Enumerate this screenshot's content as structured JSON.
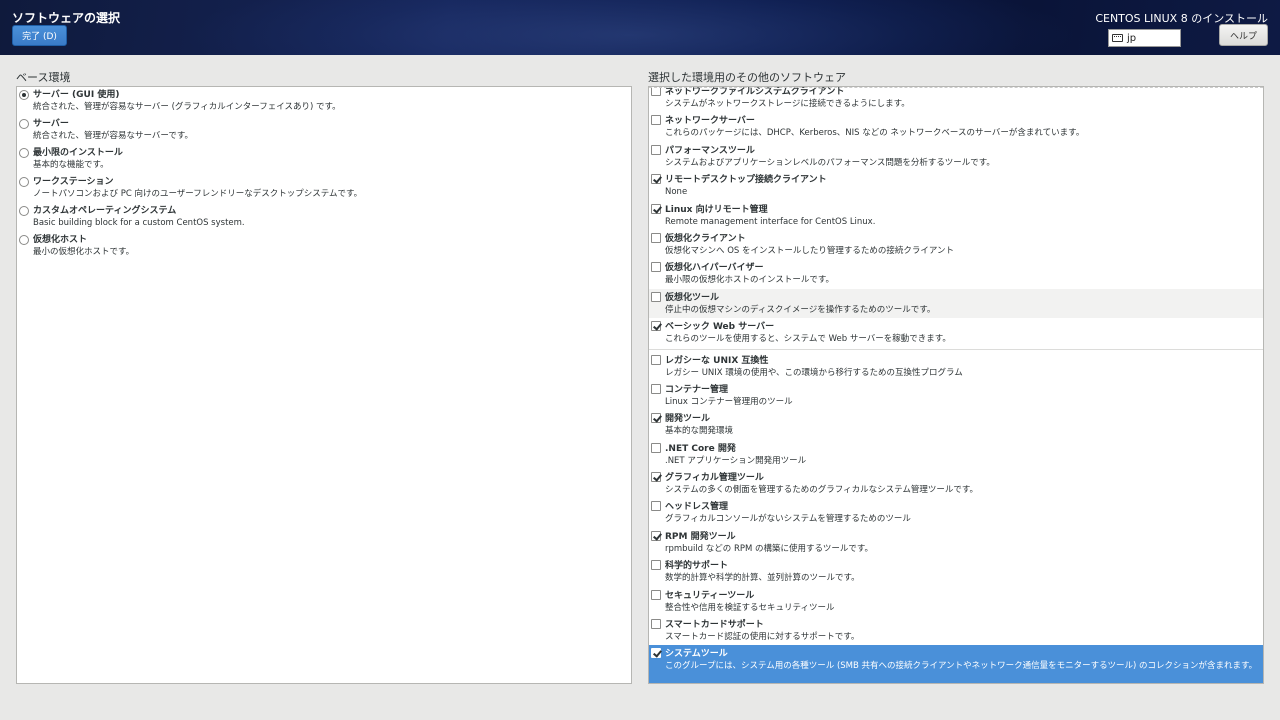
{
  "header": {
    "spoke_title": "ソフトウェアの選択",
    "done_label": "完了 (D)",
    "product_title": "CENTOS LINUX 8 のインストール",
    "keyboard_layout": "jp",
    "help_label": "ヘルプ"
  },
  "base_environment": {
    "label": "ベース環境",
    "items": [
      {
        "name": "サーバー (GUI 使用)",
        "desc": "統合された、管理が容易なサーバー (グラフィカルインターフェイスあり) です。",
        "selected": true
      },
      {
        "name": "サーバー",
        "desc": "統合された、管理が容易なサーバーです。",
        "selected": false
      },
      {
        "name": "最小限のインストール",
        "desc": "基本的な機能です。",
        "selected": false
      },
      {
        "name": "ワークステーション",
        "desc": "ノートパソコンおよび PC 向けのユーザーフレンドリーなデスクトップシステムです。",
        "selected": false
      },
      {
        "name": "カスタムオペレーティングシステム",
        "desc": "Basic building block for a custom CentOS system.",
        "selected": false
      },
      {
        "name": "仮想化ホスト",
        "desc": "最小の仮想化ホストです。",
        "selected": false
      }
    ]
  },
  "addons": {
    "label": "選択した環境用のその他のソフトウェア",
    "items": [
      {
        "name": "ネットワークファイルシステムクライアント",
        "desc": "システムがネットワークストレージに接続できるようにします。",
        "checked": false
      },
      {
        "name": "ネットワークサーバー",
        "desc": "これらのパッケージには、DHCP、Kerberos、NIS などの ネットワークベースのサーバーが含まれています。",
        "checked": false
      },
      {
        "name": "パフォーマンスツール",
        "desc": "システムおよびアプリケーションレベルのパフォーマンス問題を分析するツールです。",
        "checked": false
      },
      {
        "name": "リモートデスクトップ接続クライアント",
        "desc": "None",
        "checked": true
      },
      {
        "name": "Linux 向けリモート管理",
        "desc": "Remote management interface for CentOS Linux.",
        "checked": true
      },
      {
        "name": "仮想化クライアント",
        "desc": "仮想化マシンへ OS をインストールしたり管理するための接続クライアント",
        "checked": false
      },
      {
        "name": "仮想化ハイパーバイザー",
        "desc": "最小限の仮想化ホストのインストールです。",
        "checked": false
      },
      {
        "name": "仮想化ツール",
        "desc": "停止中の仮想マシンのディスクイメージを操作するためのツールです。",
        "checked": false
      },
      {
        "name": "ベーシック Web サーバー",
        "desc": "これらのツールを使用すると、システムで Web サーバーを稼動できます。",
        "checked": true
      }
    ],
    "items2": [
      {
        "name": "レガシーな UNIX 互換性",
        "desc": "レガシー UNIX 環境の使用や、この環境から移行するための互換性プログラム",
        "checked": false
      },
      {
        "name": "コンテナー管理",
        "desc": "Linux コンテナー管理用のツール",
        "checked": false
      },
      {
        "name": "開発ツール",
        "desc": "基本的な開発環境",
        "checked": true
      },
      {
        "name": ".NET Core 開発",
        "desc": ".NET アプリケーション開発用ツール",
        "checked": false
      },
      {
        "name": "グラフィカル管理ツール",
        "desc": "システムの多くの側面を管理するためのグラフィカルなシステム管理ツールです。",
        "checked": true
      },
      {
        "name": "ヘッドレス管理",
        "desc": "グラフィカルコンソールがないシステムを管理するためのツール",
        "checked": false
      },
      {
        "name": "RPM 開発ツール",
        "desc": "rpmbuild などの RPM の構築に使用するツールです。",
        "checked": true
      },
      {
        "name": "科学的サポート",
        "desc": "数学的計算や科学的計算、並列計算のツールです。",
        "checked": false
      },
      {
        "name": "セキュリティーツール",
        "desc": "整合性や信用を検証するセキュリティツール",
        "checked": false
      },
      {
        "name": "スマートカードサポート",
        "desc": "スマートカード認証の使用に対するサポートです。",
        "checked": false
      },
      {
        "name": "システムツール",
        "desc": "このグループには、システム用の各種ツール (SMB 共有への接続クライアントやネットワーク通信量をモニターするツール) のコレクションが含まれます。",
        "checked": true
      }
    ]
  },
  "colors": {
    "header_bg": "#0f1a3c",
    "accent": "#4a90d9",
    "panel_bg": "#ffffff",
    "page_bg": "#e8e8e7"
  }
}
